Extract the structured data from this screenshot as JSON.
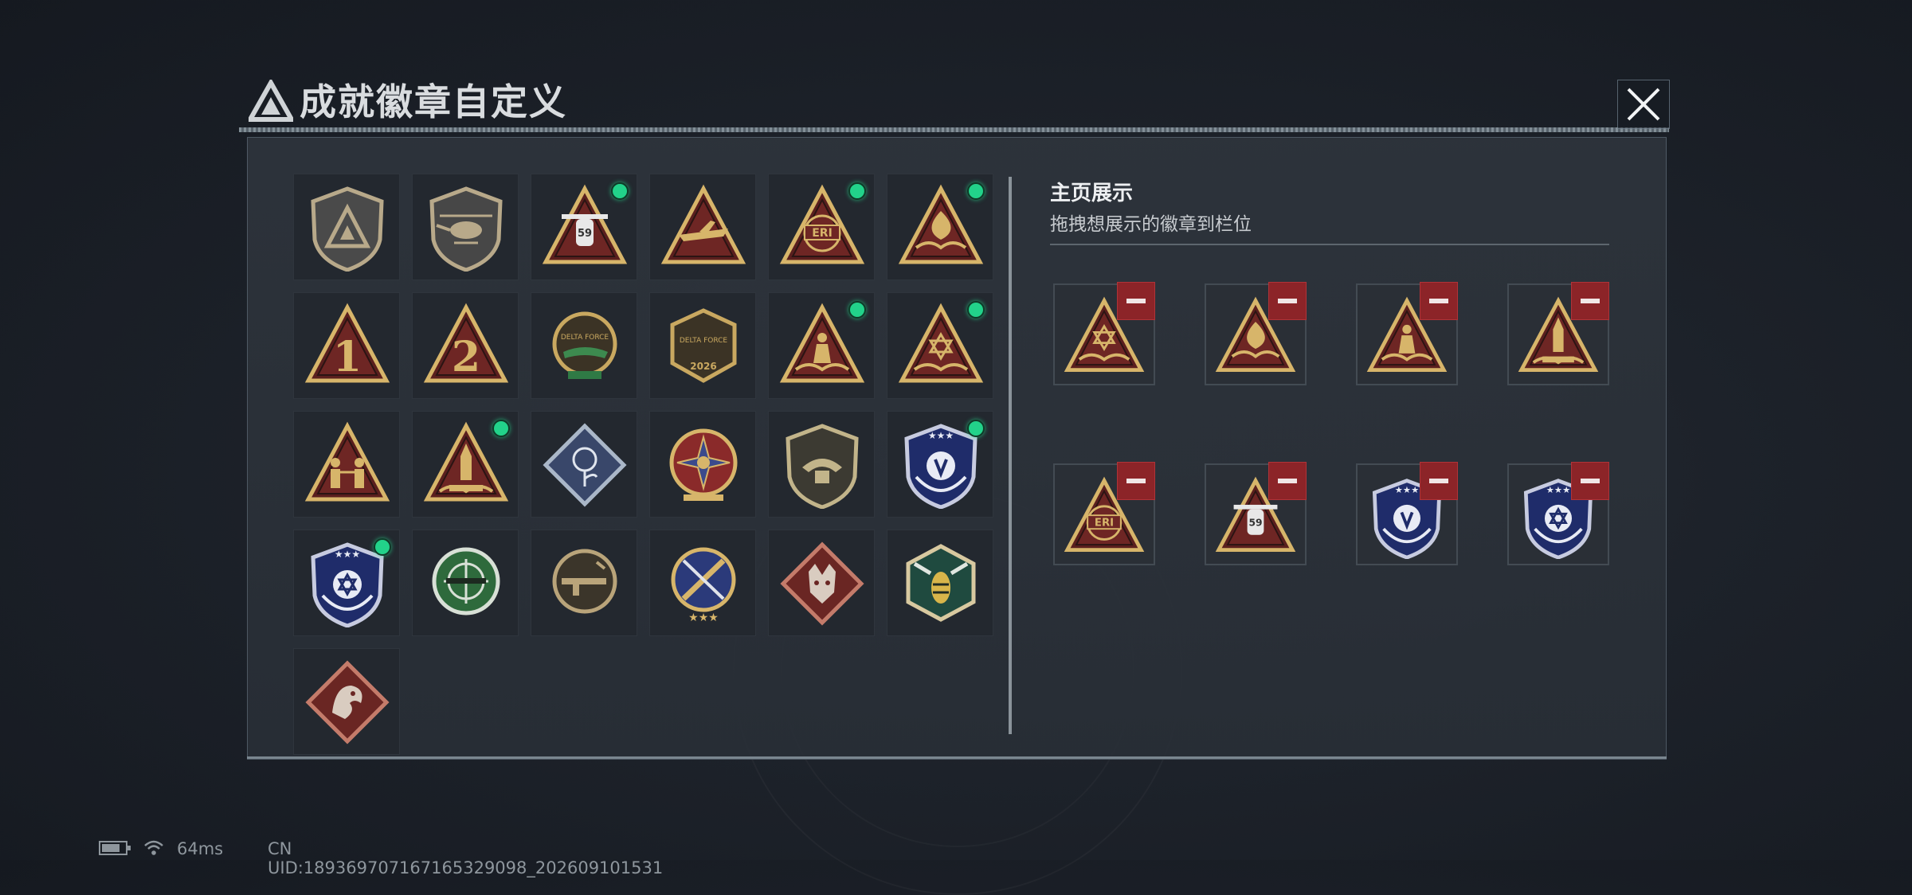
{
  "window": {
    "title": "成就徽章自定义"
  },
  "showcase": {
    "title": "主页展示",
    "subtitle": "拖拽想展示的徽章到栏位"
  },
  "badges": [
    {
      "icon": "delta-shield-icon",
      "color": "#b8a98a",
      "new": false
    },
    {
      "icon": "helicopter-shield-icon",
      "color": "#b8a98a",
      "new": false
    },
    {
      "icon": "satellite-59-triangle-icon",
      "color": "#d7b56a",
      "new": true
    },
    {
      "icon": "cargo-plane-triangle-icon",
      "color": "#d7b56a",
      "new": false
    },
    {
      "icon": "eri-globe-triangle-icon",
      "color": "#d7b56a",
      "new": true
    },
    {
      "icon": "sail-waves-triangle-icon",
      "color": "#d7b56a",
      "new": true
    },
    {
      "icon": "number-1-triangle-icon",
      "color": "#d7b56a",
      "new": false
    },
    {
      "icon": "number-2-triangle-icon",
      "color": "#d7b56a",
      "new": false
    },
    {
      "icon": "delta-force-crocodile-badge-icon",
      "color": "#c9a860",
      "new": false
    },
    {
      "icon": "delta-force-2026-badge-icon",
      "color": "#c9a860",
      "new": false
    },
    {
      "icon": "warrior-waves-triangle-icon",
      "color": "#d7b56a",
      "new": true
    },
    {
      "icon": "hex-star-waves-triangle-icon",
      "color": "#d7b56a",
      "new": true
    },
    {
      "icon": "soldiers-triangle-icon",
      "color": "#d7b56a",
      "new": false
    },
    {
      "icon": "rocket-launch-triangle-icon",
      "color": "#d7b56a",
      "new": true
    },
    {
      "icon": "rose-diamond-icon",
      "color": "#aab7c8",
      "new": false
    },
    {
      "icon": "star-compass-wreath-icon",
      "color": "#d7b56a",
      "new": false
    },
    {
      "icon": "wing-shield-icon",
      "color": "#c2b48a",
      "new": false
    },
    {
      "icon": "blue-wreath-shield-icon",
      "color": "#8fa4d8",
      "new": true
    },
    {
      "icon": "blue-hexstar-shield-icon",
      "color": "#8fa4d8",
      "new": true
    },
    {
      "icon": "crosshair-rifle-green-icon",
      "color": "#6fa57a",
      "new": false
    },
    {
      "icon": "rifle-circle-icon",
      "color": "#b9a47a",
      "new": false
    },
    {
      "icon": "sword-wreath-shield-icon",
      "color": "#d7b56a",
      "new": false
    },
    {
      "icon": "wolf-diamond-icon",
      "color": "#c47b6a",
      "new": false
    },
    {
      "icon": "hornet-hexagon-icon",
      "color": "#6fa58a",
      "new": false
    },
    {
      "icon": "dragon-diamond-icon",
      "color": "#c47b6a",
      "new": false
    }
  ],
  "slots": [
    {
      "icon": "hex-star-waves-triangle-icon",
      "color": "#d7b56a"
    },
    {
      "icon": "sail-waves-triangle-icon",
      "color": "#d7b56a"
    },
    {
      "icon": "warrior-waves-triangle-icon",
      "color": "#d7b56a"
    },
    {
      "icon": "rocket-launch-triangle-icon",
      "color": "#d7b56a"
    },
    {
      "icon": "eri-globe-triangle-icon",
      "color": "#d7b56a"
    },
    {
      "icon": "satellite-59-triangle-icon",
      "color": "#d7b56a"
    },
    {
      "icon": "blue-wreath-shield-icon",
      "color": "#8fa4d8"
    },
    {
      "icon": "blue-hexstar-shield-icon",
      "color": "#8fa4d8"
    }
  ],
  "badge_texts": {
    "eri": "ERI",
    "num59": "59",
    "one": "1",
    "two": "2",
    "df": "DELTA FORCE",
    "year": "2026"
  },
  "footer": {
    "ping": "64ms",
    "uid": "CN UID:189369707167165329098_202609101531"
  }
}
